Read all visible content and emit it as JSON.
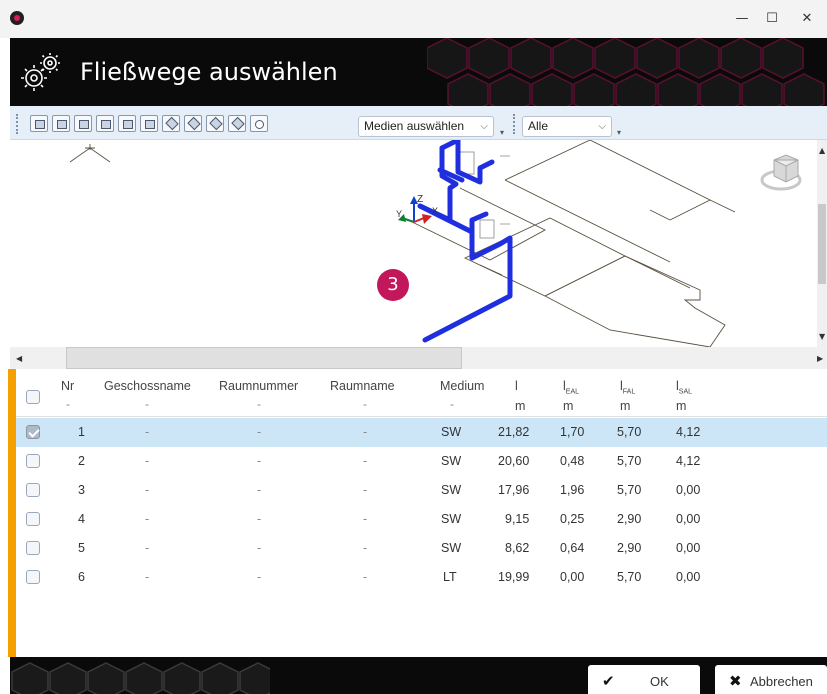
{
  "window": {
    "minimize_glyph": "—",
    "maximize_glyph": "☐",
    "close_glyph": "✕"
  },
  "header": {
    "title": "Fließwege auswählen",
    "icon": "gears-icon"
  },
  "toolbar": {
    "view_buttons": [
      "view-front-icon",
      "view-back-icon",
      "view-left-icon",
      "view-right-icon",
      "view-top-icon",
      "view-bottom-icon",
      "view-iso-sw-icon",
      "view-iso-se-icon",
      "view-iso-ne-icon",
      "view-iso-nw-icon",
      "zoom-extents-icon"
    ],
    "media_select": {
      "value": "Medien auswählen"
    },
    "filter_select": {
      "value": "Alle"
    }
  },
  "viewport": {
    "step_badge": "3",
    "axis_labels": {
      "z": "Z",
      "x": "X",
      "y": "Y"
    }
  },
  "table": {
    "headers": {
      "nr": "Nr",
      "geschossname": "Geschossname",
      "raumnummer": "Raumnummer",
      "raumname": "Raumname",
      "medium": "Medium",
      "l": "l",
      "l_eal": "EAL",
      "l_fal": "FAL",
      "l_sal": "SAL"
    },
    "sub_headers": {
      "dash": "-",
      "unit": "m"
    },
    "rows": [
      {
        "checked": true,
        "nr": "1",
        "geschoss": "-",
        "raumnummer": "-",
        "raumname": "-",
        "medium": "SW",
        "l": "21,82",
        "l_eal": "1,70",
        "l_fal": "5,70",
        "l_sal": "4,12"
      },
      {
        "checked": false,
        "nr": "2",
        "geschoss": "-",
        "raumnummer": "-",
        "raumname": "-",
        "medium": "SW",
        "l": "20,60",
        "l_eal": "0,48",
        "l_fal": "5,70",
        "l_sal": "4,12"
      },
      {
        "checked": false,
        "nr": "3",
        "geschoss": "-",
        "raumnummer": "-",
        "raumname": "-",
        "medium": "SW",
        "l": "17,96",
        "l_eal": "1,96",
        "l_fal": "5,70",
        "l_sal": "0,00"
      },
      {
        "checked": false,
        "nr": "4",
        "geschoss": "-",
        "raumnummer": "-",
        "raumname": "-",
        "medium": "SW",
        "l": "9,15",
        "l_eal": "0,25",
        "l_fal": "2,90",
        "l_sal": "0,00"
      },
      {
        "checked": false,
        "nr": "5",
        "geschoss": "-",
        "raumnummer": "-",
        "raumname": "-",
        "medium": "SW",
        "l": "8,62",
        "l_eal": "0,64",
        "l_fal": "2,90",
        "l_sal": "0,00"
      },
      {
        "checked": false,
        "nr": "6",
        "geschoss": "-",
        "raumnummer": "-",
        "raumname": "-",
        "medium": "LT",
        "l": "19,99",
        "l_eal": "0,00",
        "l_fal": "5,70",
        "l_sal": "0,00"
      }
    ]
  },
  "footer": {
    "ok_label": "OK",
    "cancel_label": "Abbrechen"
  },
  "colors": {
    "accent": "#f5a000",
    "selection": "#cde6f7",
    "brand": "#c2185b",
    "pipe": "#1f2fe0"
  }
}
